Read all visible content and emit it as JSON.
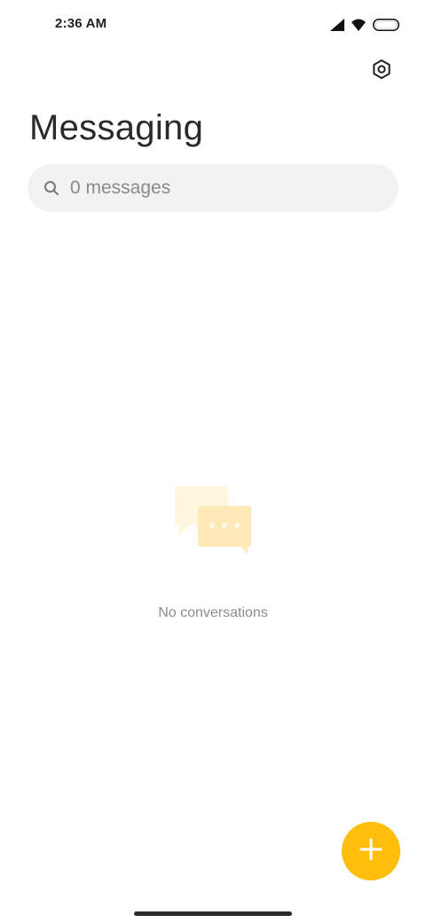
{
  "status_bar": {
    "time": "2:36 AM",
    "icons": [
      "signal-icon",
      "wifi-icon",
      "battery-icon"
    ]
  },
  "header": {
    "title": "Messaging",
    "settings_icon": "gear-icon"
  },
  "search": {
    "placeholder": "0 messages",
    "icon": "search-icon"
  },
  "empty_state": {
    "icon": "chat-bubbles-icon",
    "text": "No conversations"
  },
  "fab": {
    "icon": "plus-icon",
    "color": "#ffbe0b"
  },
  "colors": {
    "accent": "#ffbe0b",
    "search_background": "#f2f2f2",
    "illustration_light": "#fff6e0",
    "illustration_mid": "#ffe9b8"
  }
}
